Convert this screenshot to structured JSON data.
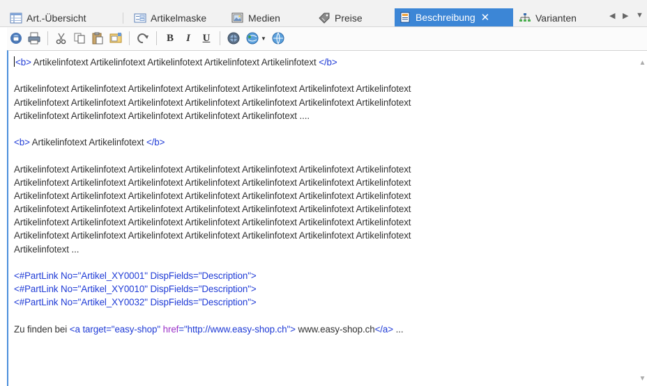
{
  "tabs": [
    {
      "label": "Art.-Übersicht",
      "icon": "grid-icon"
    },
    {
      "label": "Artikelmaske",
      "icon": "form-icon"
    },
    {
      "label": "Medien",
      "icon": "image-icon"
    },
    {
      "label": "Preise",
      "icon": "price-tag-icon"
    },
    {
      "label": "Beschreibung",
      "icon": "document-icon",
      "active": true,
      "close": "✕"
    },
    {
      "label": "Varianten",
      "icon": "tree-icon"
    }
  ],
  "nav": {
    "prev": "◀",
    "next": "▶",
    "menu": "▼"
  },
  "toolbar": {
    "bold": "B",
    "italic": "I",
    "underline": "U"
  },
  "editor": {
    "lines": [
      [
        {
          "t": "<b>",
          "c": "tag"
        },
        {
          "t": " Artikelinfotext Artikelinfotext Artikelinfotext Artikelinfotext Artikelinfotext "
        },
        {
          "t": "</b>",
          "c": "tag"
        }
      ],
      [],
      [
        {
          "t": "Artikelinfotext Artikelinfotext Artikelinfotext Artikelinfotext Artikelinfotext Artikelinfotext Artikelinfotext"
        }
      ],
      [
        {
          "t": "Artikelinfotext Artikelinfotext Artikelinfotext Artikelinfotext Artikelinfotext Artikelinfotext Artikelinfotext"
        }
      ],
      [
        {
          "t": "Artikelinfotext Artikelinfotext Artikelinfotext Artikelinfotext Artikelinfotext ...."
        }
      ],
      [],
      [
        {
          "t": "<b>",
          "c": "tag"
        },
        {
          "t": " Artikelinfotext Artikelinfotext "
        },
        {
          "t": "</b>",
          "c": "tag"
        }
      ],
      [],
      [
        {
          "t": "Artikelinfotext Artikelinfotext Artikelinfotext Artikelinfotext Artikelinfotext Artikelinfotext Artikelinfotext"
        }
      ],
      [
        {
          "t": "Artikelinfotext Artikelinfotext Artikelinfotext Artikelinfotext Artikelinfotext Artikelinfotext Artikelinfotext"
        }
      ],
      [
        {
          "t": "Artikelinfotext Artikelinfotext Artikelinfotext Artikelinfotext Artikelinfotext Artikelinfotext Artikelinfotext"
        }
      ],
      [
        {
          "t": "Artikelinfotext Artikelinfotext Artikelinfotext Artikelinfotext Artikelinfotext Artikelinfotext Artikelinfotext"
        }
      ],
      [
        {
          "t": "Artikelinfotext Artikelinfotext Artikelinfotext Artikelinfotext Artikelinfotext Artikelinfotext Artikelinfotext"
        }
      ],
      [
        {
          "t": "Artikelinfotext Artikelinfotext Artikelinfotext Artikelinfotext Artikelinfotext Artikelinfotext Artikelinfotext"
        }
      ],
      [
        {
          "t": "Artikelinfotext ..."
        }
      ],
      [],
      [
        {
          "t": "<#PartLink No=\"Artikel_XY0001\" DispFields=\"Description\">",
          "c": "tag"
        }
      ],
      [
        {
          "t": "<#PartLink No=\"Artikel_XY0010\" DispFields=\"Description\">",
          "c": "tag"
        }
      ],
      [
        {
          "t": "<#PartLink No=\"Artikel_XY0032\" DispFields=\"Description\">",
          "c": "tag"
        }
      ],
      [],
      [
        {
          "t": "Zu finden bei "
        },
        {
          "t": "<a target=\"easy-shop\" ",
          "c": "tag"
        },
        {
          "t": "href",
          "c": "attr"
        },
        {
          "t": "=\"http://www.easy-shop.ch\">",
          "c": "tag"
        },
        {
          "t": " www.easy-shop.ch"
        },
        {
          "t": "</a>",
          "c": "tag"
        },
        {
          "t": " ..."
        }
      ]
    ]
  },
  "scrollbar": {
    "up": "▲",
    "down": "▼"
  }
}
